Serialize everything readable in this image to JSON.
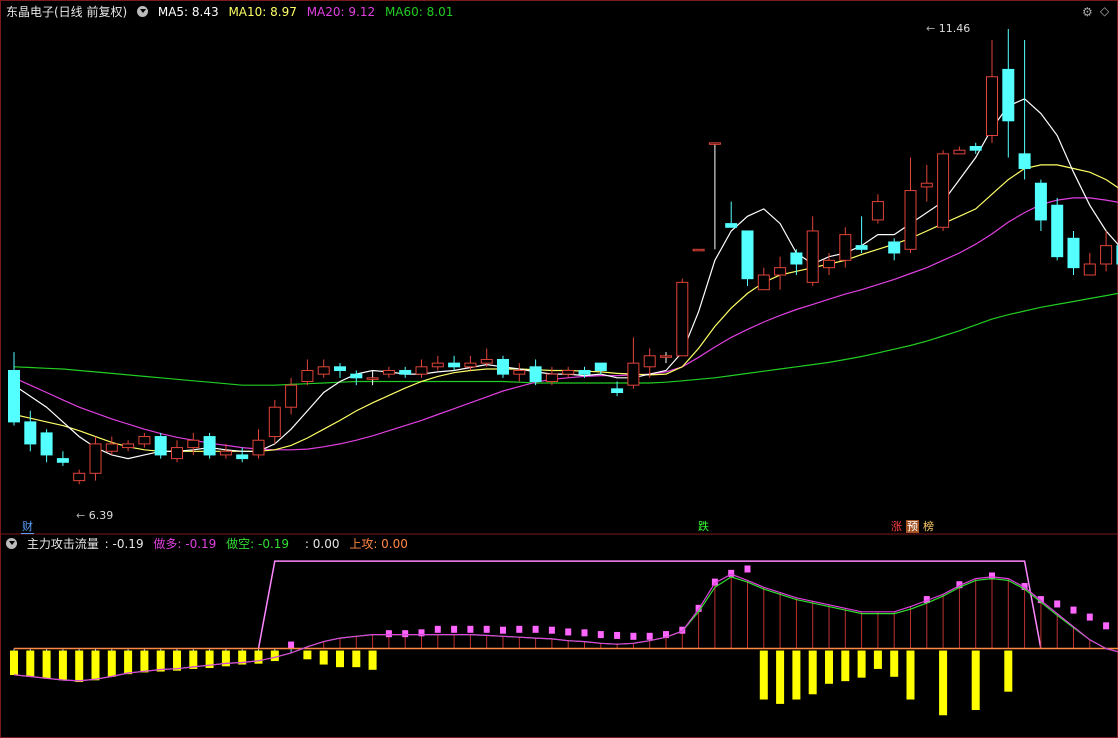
{
  "main_header": {
    "title": "东晶电子(日线 前复权)",
    "ma5": "MA5: 8.43",
    "ma10": "MA10: 8.97",
    "ma20": "MA20: 9.12",
    "ma60": "MA60: 8.01"
  },
  "sub_header": {
    "title": "主力攻击流量",
    "value": ": -0.19",
    "zuoduo": "做多: -0.19",
    "zuokong": "做空: -0.19",
    "blank_value": ": 0.00",
    "shanggong": "上攻: 0.00"
  },
  "annotations": {
    "high_label": "11.46",
    "low_label": "6.39",
    "marker_cai": "财",
    "marker_die": "跌",
    "marker_zhang": "涨",
    "marker_yu": "预",
    "marker_bang": "榜"
  },
  "colors": {
    "up": "#e0443a",
    "down": "#54ffff",
    "ma5": "#ffffff",
    "ma10": "#ffff66",
    "ma20": "#e040e0",
    "ma60": "#22cc22",
    "bar_pos": "#ff66ff",
    "bar_neg": "#ffff00",
    "line_zuoduo": "#e040e0",
    "line_zuokong": "#33dd33",
    "line_shanggong": "#ff8844",
    "frame": "#7a1a1a"
  },
  "chart_data": {
    "type": "candlestick",
    "candles": [
      [
        8.1,
        7.4,
        8.35,
        7.35
      ],
      [
        7.4,
        7.1,
        7.55,
        7.0
      ],
      [
        7.25,
        6.95,
        7.3,
        6.85
      ],
      [
        6.9,
        6.85,
        7.0,
        6.8
      ],
      [
        6.6,
        6.7,
        6.75,
        6.55
      ],
      [
        6.7,
        7.1,
        7.2,
        6.6
      ],
      [
        7.0,
        7.1,
        7.2,
        6.95
      ],
      [
        7.05,
        7.1,
        7.15,
        7.0
      ],
      [
        7.1,
        7.2,
        7.25,
        7.05
      ],
      [
        7.2,
        6.95,
        7.25,
        6.9
      ],
      [
        6.9,
        7.05,
        7.15,
        6.85
      ],
      [
        7.05,
        7.15,
        7.25,
        6.95
      ],
      [
        7.2,
        6.95,
        7.25,
        6.9
      ],
      [
        6.95,
        7.0,
        7.1,
        6.9
      ],
      [
        6.95,
        6.9,
        7.05,
        6.85
      ],
      [
        6.95,
        7.15,
        7.3,
        6.9
      ],
      [
        7.2,
        7.6,
        7.7,
        7.1
      ],
      [
        7.6,
        7.9,
        8.0,
        7.5
      ],
      [
        7.95,
        8.1,
        8.25,
        7.9
      ],
      [
        8.05,
        8.15,
        8.25,
        8.0
      ],
      [
        8.15,
        8.1,
        8.2,
        8.0
      ],
      [
        8.05,
        8.0,
        8.1,
        7.9
      ],
      [
        8.0,
        8.0,
        8.1,
        7.9
      ],
      [
        8.05,
        8.1,
        8.15,
        8.0
      ],
      [
        8.1,
        8.05,
        8.15,
        8.0
      ],
      [
        8.05,
        8.15,
        8.25,
        8.0
      ],
      [
        8.15,
        8.2,
        8.3,
        8.1
      ],
      [
        8.2,
        8.15,
        8.3,
        8.1
      ],
      [
        8.15,
        8.2,
        8.3,
        8.1
      ],
      [
        8.2,
        8.25,
        8.4,
        8.15
      ],
      [
        8.25,
        8.05,
        8.3,
        8.0
      ],
      [
        8.05,
        8.1,
        8.2,
        7.95
      ],
      [
        8.15,
        7.95,
        8.25,
        7.9
      ],
      [
        7.95,
        8.05,
        8.15,
        7.9
      ],
      [
        8.05,
        8.1,
        8.15,
        8.0
      ],
      [
        8.1,
        8.05,
        8.15,
        8.0
      ],
      [
        8.2,
        8.1,
        8.2,
        8.05
      ],
      [
        7.85,
        7.8,
        7.95,
        7.75
      ],
      [
        7.9,
        8.2,
        8.55,
        7.85
      ],
      [
        8.15,
        8.3,
        8.4,
        8.0
      ],
      [
        8.3,
        8.3,
        8.35,
        8.2
      ],
      [
        8.3,
        9.3,
        9.35,
        8.3
      ],
      [
        9.75,
        9.75,
        9.75,
        9.75
      ],
      [
        11.2,
        11.2,
        11.2,
        9.75
      ],
      [
        10.1,
        10.05,
        10.4,
        10.05
      ],
      [
        10.0,
        9.35,
        10.0,
        9.25
      ],
      [
        9.2,
        9.4,
        9.5,
        9.2
      ],
      [
        9.4,
        9.5,
        9.65,
        9.2
      ],
      [
        9.7,
        9.55,
        9.75,
        9.4
      ],
      [
        9.3,
        10.0,
        10.2,
        9.25
      ],
      [
        9.5,
        9.6,
        9.7,
        9.4
      ],
      [
        9.6,
        9.95,
        10.05,
        9.5
      ],
      [
        9.8,
        9.75,
        10.2,
        9.7
      ],
      [
        10.15,
        10.4,
        10.5,
        10.1
      ],
      [
        9.85,
        9.7,
        9.9,
        9.6
      ],
      [
        9.75,
        10.55,
        11.0,
        9.7
      ],
      [
        10.6,
        10.65,
        10.9,
        10.4
      ],
      [
        10.05,
        11.05,
        11.1,
        10.0
      ],
      [
        11.05,
        11.1,
        11.15,
        11.05
      ],
      [
        11.15,
        11.1,
        11.2,
        11.05
      ],
      [
        11.3,
        12.1,
        12.6,
        11.2
      ],
      [
        12.2,
        11.5,
        12.75,
        11.0
      ],
      [
        11.05,
        10.85,
        12.6,
        10.7
      ],
      [
        10.65,
        10.15,
        10.7,
        10.0
      ],
      [
        10.35,
        9.65,
        10.45,
        9.6
      ],
      [
        9.9,
        9.5,
        10.0,
        9.4
      ],
      [
        9.4,
        9.55,
        9.7,
        9.4
      ],
      [
        9.55,
        9.8,
        10.0,
        9.45
      ],
      [
        9.8,
        9.55,
        9.85,
        9.5
      ],
      [
        9.5,
        9.3,
        9.55,
        9.2
      ],
      [
        9.3,
        9.25,
        9.35,
        9.2
      ]
    ],
    "ma5": [
      7.9,
      7.75,
      7.6,
      7.4,
      7.2,
      7.05,
      6.95,
      6.9,
      6.95,
      7.0,
      7.0,
      7.02,
      7.05,
      7.02,
      7.0,
      7.0,
      7.1,
      7.3,
      7.55,
      7.8,
      7.95,
      8.05,
      8.1,
      8.08,
      8.05,
      8.05,
      8.08,
      8.1,
      8.14,
      8.18,
      8.15,
      8.12,
      8.08,
      8.05,
      8.05,
      8.03,
      8.05,
      8.0,
      8.0,
      8.05,
      8.1,
      8.35,
      8.9,
      9.6,
      10.0,
      10.2,
      10.3,
      10.1,
      9.7,
      9.55,
      9.65,
      9.7,
      9.8,
      9.95,
      9.95,
      10.1,
      10.25,
      10.4,
      10.7,
      11.0,
      11.4,
      11.7,
      11.8,
      11.6,
      11.3,
      10.8,
      10.35,
      10.0,
      9.75,
      9.55,
      9.45
    ],
    "ma10": [
      7.5,
      7.45,
      7.4,
      7.35,
      7.28,
      7.2,
      7.12,
      7.06,
      7.02,
      7.0,
      7.0,
      7.0,
      7.0,
      7.0,
      7.0,
      7.0,
      7.02,
      7.08,
      7.18,
      7.3,
      7.42,
      7.55,
      7.66,
      7.76,
      7.86,
      7.95,
      8.02,
      8.07,
      8.1,
      8.12,
      8.12,
      8.12,
      8.11,
      8.1,
      8.1,
      8.09,
      8.08,
      8.06,
      8.05,
      8.04,
      8.05,
      8.15,
      8.4,
      8.7,
      8.95,
      9.15,
      9.3,
      9.4,
      9.45,
      9.5,
      9.55,
      9.6,
      9.68,
      9.75,
      9.82,
      9.9,
      10.0,
      10.1,
      10.2,
      10.3,
      10.5,
      10.7,
      10.85,
      10.9,
      10.9,
      10.85,
      10.8,
      10.7,
      10.55,
      10.35,
      10.1
    ],
    "ma20": [
      8.0,
      7.9,
      7.8,
      7.7,
      7.6,
      7.52,
      7.44,
      7.37,
      7.3,
      7.24,
      7.19,
      7.15,
      7.11,
      7.08,
      7.05,
      7.03,
      7.02,
      7.02,
      7.03,
      7.06,
      7.1,
      7.15,
      7.21,
      7.28,
      7.35,
      7.42,
      7.5,
      7.58,
      7.66,
      7.74,
      7.82,
      7.88,
      7.94,
      7.98,
      8.0,
      8.02,
      8.03,
      8.03,
      8.04,
      8.05,
      8.08,
      8.15,
      8.28,
      8.42,
      8.55,
      8.66,
      8.76,
      8.85,
      8.93,
      9.0,
      9.07,
      9.14,
      9.2,
      9.27,
      9.34,
      9.42,
      9.5,
      9.6,
      9.7,
      9.82,
      9.96,
      10.12,
      10.25,
      10.36,
      10.42,
      10.45,
      10.45,
      10.42,
      10.38,
      10.35,
      10.3
    ],
    "ma60": [
      8.15,
      8.14,
      8.13,
      8.12,
      8.1,
      8.08,
      8.06,
      8.04,
      8.02,
      8.0,
      7.98,
      7.96,
      7.94,
      7.92,
      7.9,
      7.9,
      7.9,
      7.91,
      7.92,
      7.93,
      7.94,
      7.95,
      7.95,
      7.95,
      7.95,
      7.95,
      7.95,
      7.95,
      7.95,
      7.95,
      7.95,
      7.94,
      7.93,
      7.93,
      7.93,
      7.93,
      7.93,
      7.93,
      7.93,
      7.93,
      7.94,
      7.96,
      7.98,
      8.0,
      8.03,
      8.06,
      8.09,
      8.12,
      8.15,
      8.18,
      8.21,
      8.25,
      8.29,
      8.34,
      8.39,
      8.44,
      8.5,
      8.57,
      8.64,
      8.72,
      8.8,
      8.86,
      8.91,
      8.96,
      9.0,
      9.04,
      9.08,
      9.12,
      9.16,
      9.2,
      9.24
    ],
    "ylim": [
      6.2,
      12.9
    ],
    "indicator": {
      "bars": [
        -0.28,
        -0.3,
        -0.32,
        -0.34,
        -0.36,
        -0.34,
        -0.3,
        -0.27,
        -0.25,
        -0.24,
        -0.23,
        -0.21,
        -0.2,
        -0.18,
        -0.16,
        -0.15,
        -0.12,
        0.08,
        -0.1,
        -0.16,
        -0.19,
        -0.19,
        -0.22,
        0.18,
        0.2,
        0.22,
        0.26,
        0.26,
        0.26,
        0.26,
        0.25,
        0.26,
        0.26,
        0.25,
        0.23,
        0.22,
        0.2,
        0.19,
        0.18,
        0.18,
        0.2,
        0.22,
        0.25,
        0.38,
        0.65,
        0.95,
        -0.56,
        -0.61,
        -0.56,
        -0.5,
        -0.38,
        -0.35,
        -0.31,
        -0.21,
        -0.3,
        -0.56,
        0.55,
        -0.74,
        0.68,
        -0.68,
        0.55,
        -0.47,
        0.52,
        0.6,
        0.55,
        0.48,
        0.4,
        0.3,
        0.2,
        0.1,
        -0.19
      ],
      "zuoduo": [
        -0.3,
        -0.32,
        -0.34,
        -0.36,
        -0.37,
        -0.35,
        -0.32,
        -0.28,
        -0.26,
        -0.24,
        -0.23,
        -0.21,
        -0.19,
        -0.17,
        -0.16,
        -0.14,
        -0.1,
        -0.05,
        0.02,
        0.08,
        0.12,
        0.14,
        0.16,
        0.16,
        0.16,
        0.16,
        0.16,
        0.16,
        0.16,
        0.15,
        0.14,
        0.13,
        0.12,
        0.11,
        0.09,
        0.08,
        0.06,
        0.05,
        0.06,
        0.09,
        0.13,
        0.2,
        0.45,
        0.75,
        0.85,
        0.78,
        0.7,
        0.64,
        0.58,
        0.54,
        0.5,
        0.46,
        0.42,
        0.42,
        0.42,
        0.48,
        0.55,
        0.62,
        0.72,
        0.8,
        0.82,
        0.8,
        0.7,
        0.55,
        0.4,
        0.25,
        0.1,
        0.0,
        -0.05,
        -0.12,
        -0.19
      ],
      "zuokong": [
        -0.3,
        -0.32,
        -0.34,
        -0.36,
        -0.37,
        -0.35,
        -0.32,
        -0.28,
        -0.26,
        -0.24,
        -0.23,
        -0.21,
        -0.19,
        -0.17,
        -0.16,
        -0.14,
        -0.1,
        -0.05,
        0.02,
        0.08,
        0.12,
        0.14,
        0.16,
        0.16,
        0.16,
        0.16,
        0.16,
        0.16,
        0.16,
        0.15,
        0.14,
        0.13,
        0.12,
        0.11,
        0.09,
        0.08,
        0.06,
        0.05,
        0.06,
        0.09,
        0.13,
        0.2,
        0.42,
        0.7,
        0.82,
        0.76,
        0.68,
        0.62,
        0.56,
        0.52,
        0.48,
        0.44,
        0.4,
        0.4,
        0.4,
        0.45,
        0.52,
        0.6,
        0.7,
        0.78,
        0.8,
        0.78,
        0.68,
        0.53,
        0.38,
        0.24,
        0.1,
        0.0,
        -0.05,
        -0.12,
        -0.19
      ],
      "shanggong_level": 1.0,
      "shanggong_range": [
        16,
        62
      ],
      "ylim": [
        -1.0,
        1.15
      ]
    }
  }
}
